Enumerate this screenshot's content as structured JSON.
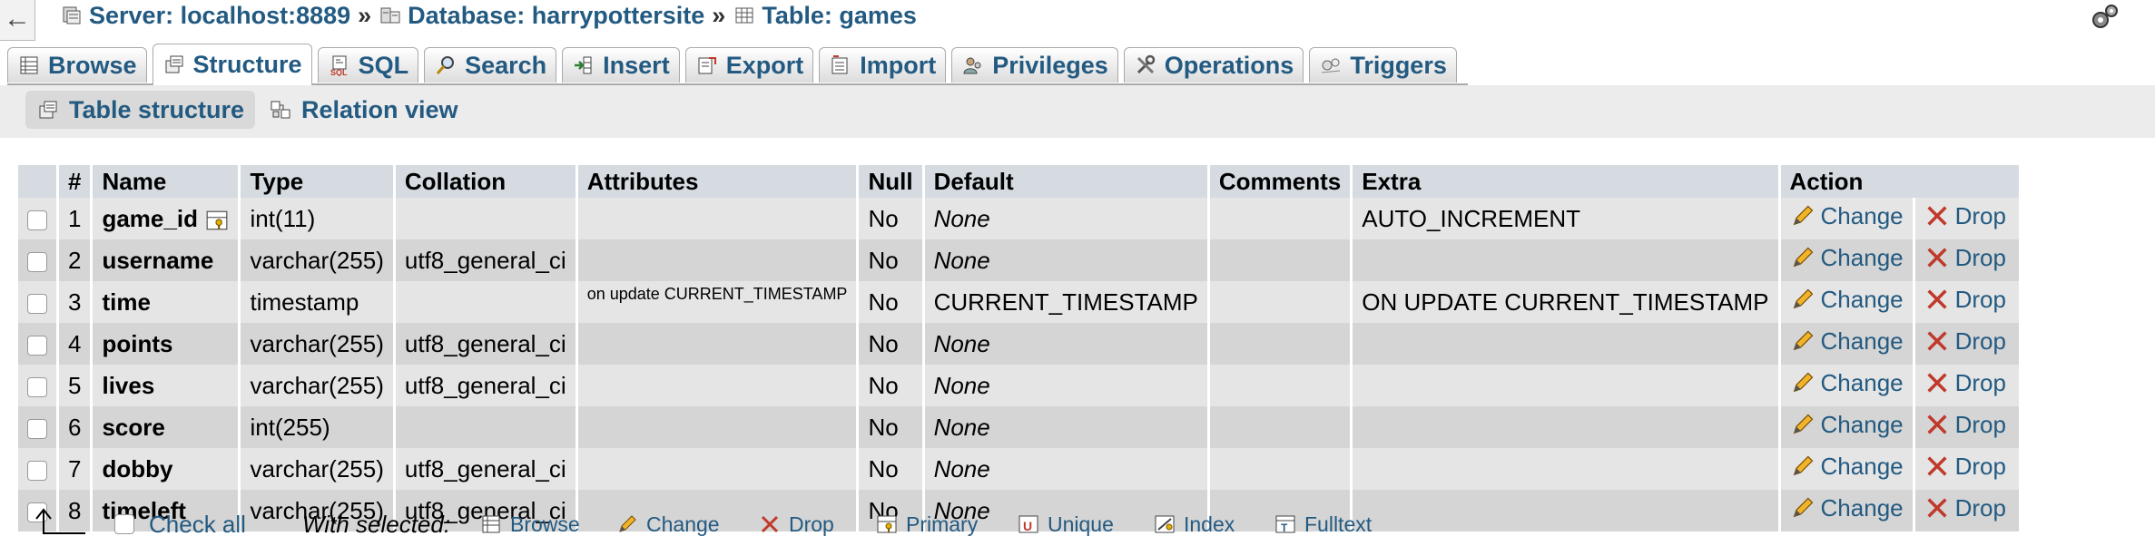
{
  "nav": {
    "back_glyph": "←"
  },
  "breadcrumb": {
    "server": "Server: localhost:8889",
    "database": "Database: harrypottersite",
    "table": "Table: games",
    "separator": "»"
  },
  "tabs": [
    {
      "label": "Browse",
      "icon": "browse-icon",
      "active": false
    },
    {
      "label": "Structure",
      "icon": "structure-icon",
      "active": true
    },
    {
      "label": "SQL",
      "icon": "sql-icon",
      "active": false
    },
    {
      "label": "Search",
      "icon": "search-icon",
      "active": false
    },
    {
      "label": "Insert",
      "icon": "insert-icon",
      "active": false
    },
    {
      "label": "Export",
      "icon": "export-icon",
      "active": false
    },
    {
      "label": "Import",
      "icon": "import-icon",
      "active": false
    },
    {
      "label": "Privileges",
      "icon": "privileges-icon",
      "active": false
    },
    {
      "label": "Operations",
      "icon": "operations-icon",
      "active": false
    },
    {
      "label": "Triggers",
      "icon": "triggers-icon",
      "active": false
    }
  ],
  "subtabs": {
    "table_structure": "Table structure",
    "relation_view": "Relation view"
  },
  "columns": {
    "num": "#",
    "name": "Name",
    "type": "Type",
    "collation": "Collation",
    "attributes": "Attributes",
    "null": "Null",
    "default": "Default",
    "comments": "Comments",
    "extra": "Extra",
    "action": "Action"
  },
  "rows": [
    {
      "num": "1",
      "name": "game_id",
      "type": "int(11)",
      "collation": "",
      "attributes": "",
      "null": "No",
      "default": "None",
      "default_italic": true,
      "comments": "",
      "extra": "AUTO_INCREMENT"
    },
    {
      "num": "2",
      "name": "username",
      "type": "varchar(255)",
      "collation": "utf8_general_ci",
      "attributes": "",
      "null": "No",
      "default": "None",
      "default_italic": true,
      "comments": "",
      "extra": ""
    },
    {
      "num": "3",
      "name": "time",
      "type": "timestamp",
      "collation": "",
      "attributes": "on update CURRENT_TIMESTAMP",
      "null": "No",
      "default": "CURRENT_TIMESTAMP",
      "default_italic": false,
      "comments": "",
      "extra": "ON UPDATE CURRENT_TIMESTAMP"
    },
    {
      "num": "4",
      "name": "points",
      "type": "varchar(255)",
      "collation": "utf8_general_ci",
      "attributes": "",
      "null": "No",
      "default": "None",
      "default_italic": true,
      "comments": "",
      "extra": ""
    },
    {
      "num": "5",
      "name": "lives",
      "type": "varchar(255)",
      "collation": "utf8_general_ci",
      "attributes": "",
      "null": "No",
      "default": "None",
      "default_italic": true,
      "comments": "",
      "extra": ""
    },
    {
      "num": "6",
      "name": "score",
      "type": "int(255)",
      "collation": "",
      "attributes": "",
      "null": "No",
      "default": "None",
      "default_italic": true,
      "comments": "",
      "extra": ""
    },
    {
      "num": "7",
      "name": "dobby",
      "type": "varchar(255)",
      "collation": "utf8_general_ci",
      "attributes": "",
      "null": "No",
      "default": "None",
      "default_italic": true,
      "comments": "",
      "extra": ""
    },
    {
      "num": "8",
      "name": "timeleft",
      "type": "varchar(255)",
      "collation": "utf8_general_ci",
      "attributes": "",
      "null": "No",
      "default": "None",
      "default_italic": true,
      "comments": "",
      "extra": ""
    }
  ],
  "actions": {
    "change": "Change",
    "drop": "Drop"
  },
  "bottom": {
    "check_all": "Check all",
    "with_selected": "With selected:",
    "browse": "Browse",
    "change": "Change",
    "drop": "Drop",
    "primary": "Primary",
    "unique": "Unique",
    "index": "Index",
    "fulltext": "Fulltext"
  },
  "colors": {
    "link": "#235a81",
    "header_bg": "#d5dbe1",
    "row_odd": "#e5e5e5",
    "row_even": "#d5d5d5",
    "drop_red": "#c0392b"
  }
}
